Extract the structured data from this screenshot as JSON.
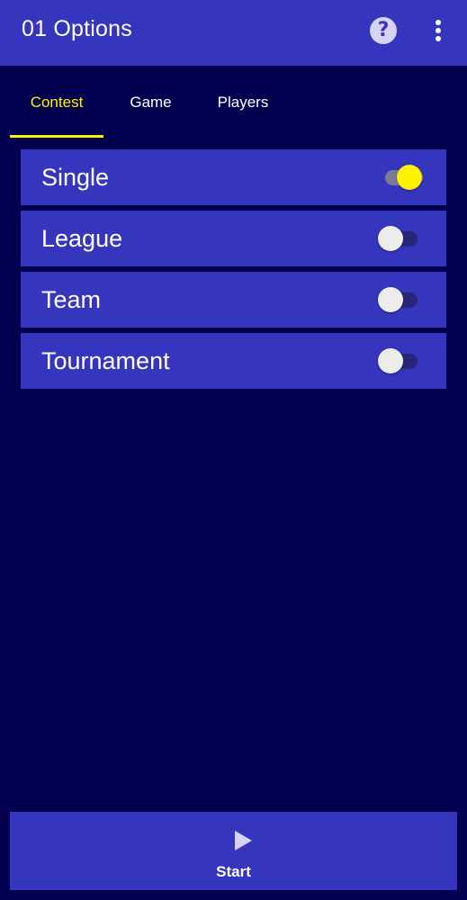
{
  "appbar": {
    "title": "01 Options",
    "help_icon": "help-circle-icon",
    "help_glyph": "?",
    "more_icon": "more-vert-icon"
  },
  "tabs": [
    {
      "label": "Contest",
      "active": true
    },
    {
      "label": "Game",
      "active": false
    },
    {
      "label": "Players",
      "active": false
    }
  ],
  "options": [
    {
      "label": "Single",
      "enabled": true
    },
    {
      "label": "League",
      "enabled": false
    },
    {
      "label": "Team",
      "enabled": false
    },
    {
      "label": "Tournament",
      "enabled": false
    }
  ],
  "start_button": {
    "label": "Start",
    "icon": "play-icon"
  },
  "colors": {
    "background": "#02004e",
    "primary": "#3535bd",
    "accent": "#fff200",
    "text": "#ffffff"
  }
}
